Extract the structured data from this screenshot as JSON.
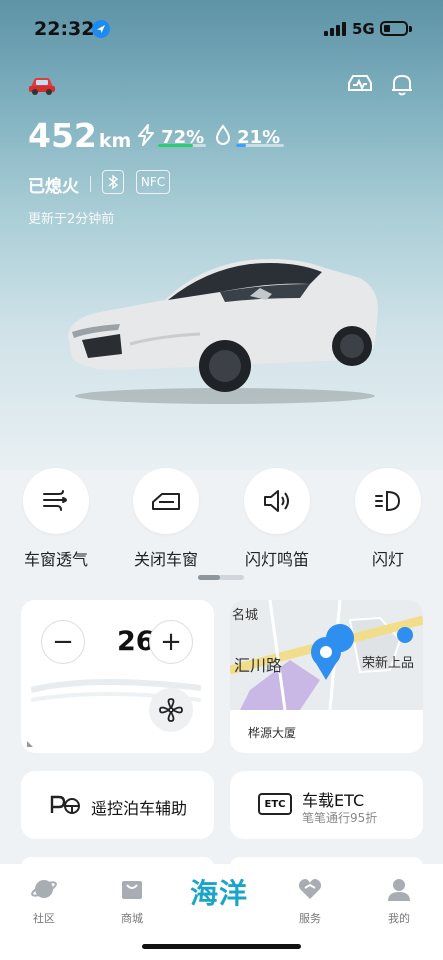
{
  "status_bar": {
    "time": "22:32",
    "network": "5G"
  },
  "vehicle": {
    "range_value": "452",
    "range_unit": "km",
    "battery_percent": "72%",
    "battery_level": 0.72,
    "humidity_percent": "21%",
    "humidity_level": 0.21,
    "engine_state": "已熄火",
    "bluetooth_chip": "bluetooth-icon",
    "nfc_chip": "NFC",
    "updated": "更新于2分钟前"
  },
  "quick_actions": [
    {
      "label": "车窗透气",
      "icon": "window-vent-icon"
    },
    {
      "label": "关闭车窗",
      "icon": "window-close-icon"
    },
    {
      "label": "闪灯鸣笛",
      "icon": "horn-icon"
    },
    {
      "label": "闪灯",
      "icon": "headlight-icon"
    }
  ],
  "climate": {
    "minus": "−",
    "plus": "+",
    "temperature": "26°"
  },
  "map": {
    "road": "汇川路",
    "poi": "荣新上品",
    "top_label": "名城",
    "caption": "桦源大厦"
  },
  "parking": {
    "label": "遥控泊车辅助"
  },
  "etc": {
    "badge": "ETC",
    "title": "车载ETC",
    "subtitle": "笔笔通行95折"
  },
  "tabs": [
    {
      "label": "社区",
      "icon": "planet-icon"
    },
    {
      "label": "商城",
      "icon": "shop-bag-icon"
    },
    {
      "label": "海洋",
      "icon": "ocean-logo"
    },
    {
      "label": "服务",
      "icon": "service-heart-icon"
    },
    {
      "label": "我的",
      "icon": "profile-icon"
    }
  ],
  "colors": {
    "battery_bar": "#2ecc71",
    "humidity_bar": "#3aa0ff",
    "brand": "#1aa4c7",
    "location_pin": "#2f8ff0"
  }
}
